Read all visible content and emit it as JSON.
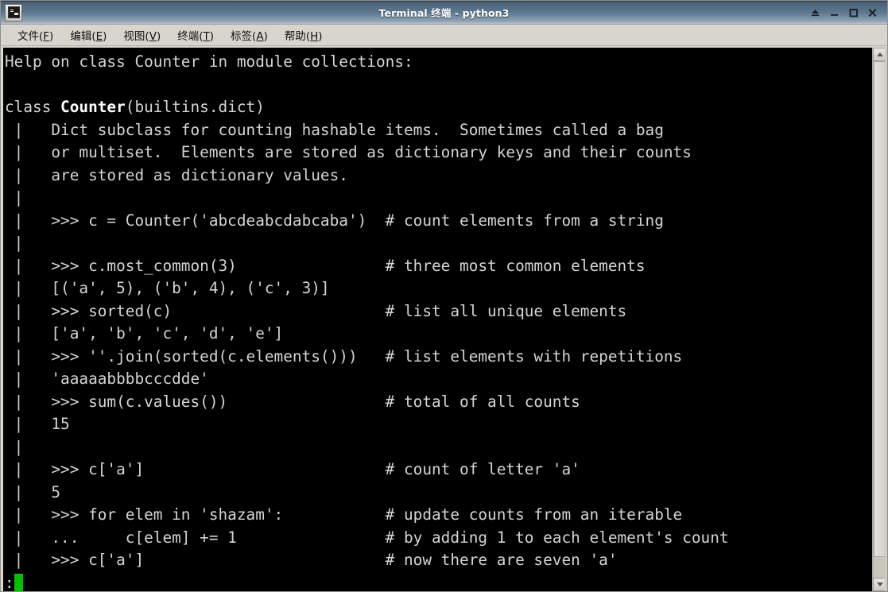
{
  "window": {
    "title": "Terminal 终端 - python3",
    "icon": "terminal-icon",
    "controls": [
      {
        "name": "shade-button",
        "glyph": "shade"
      },
      {
        "name": "minimize-button",
        "glyph": "minimize"
      },
      {
        "name": "maximize-button",
        "glyph": "maximize"
      },
      {
        "name": "close-button",
        "glyph": "close"
      }
    ]
  },
  "menubar": {
    "items": [
      {
        "label": "文件",
        "accel": "F"
      },
      {
        "label": "编辑",
        "accel": "E"
      },
      {
        "label": "视图",
        "accel": "V"
      },
      {
        "label": "终端",
        "accel": "T"
      },
      {
        "label": "标签",
        "accel": "A"
      },
      {
        "label": "帮助",
        "accel": "H"
      }
    ]
  },
  "terminal": {
    "background": "#000000",
    "foreground": "#d4d4d4",
    "cursor_color": "#00c000",
    "lines": [
      "Help on class Counter in module collections:",
      "",
      "class ",
      " |   Dict subclass for counting hashable items.  Sometimes called a bag",
      " |   or multiset.  Elements are stored as dictionary keys and their counts",
      " |   are stored as dictionary values.",
      " |",
      " |   >>> c = Counter('abcdeabcdabcaba')  # count elements from a string",
      " |",
      " |   >>> c.most_common(3)                # three most common elements",
      " |   [('a', 5), ('b', 4), ('c', 3)]",
      " |   >>> sorted(c)                       # list all unique elements",
      " |   ['a', 'b', 'c', 'd', 'e']",
      " |   >>> ''.join(sorted(c.elements()))   # list elements with repetitions",
      " |   'aaaaabbbbcccdde'",
      " |   >>> sum(c.values())                 # total of all counts",
      " |   15",
      " |",
      " |   >>> c['a']                          # count of letter 'a'",
      " |   5",
      " |   >>> for elem in 'shazam':           # update counts from an iterable",
      " |   ...     c[elem] += 1                # by adding 1 to each element's count",
      " |   >>> c['a']                          # now there are seven 'a'"
    ],
    "class_line_prefix": "class ",
    "class_line_bold": "Counter",
    "class_line_suffix": "(builtins.dict)",
    "pager_prompt": ":"
  },
  "scrollbar": {
    "up_arrow": "scroll-up-arrow",
    "down_arrow": "scroll-down-arrow"
  }
}
